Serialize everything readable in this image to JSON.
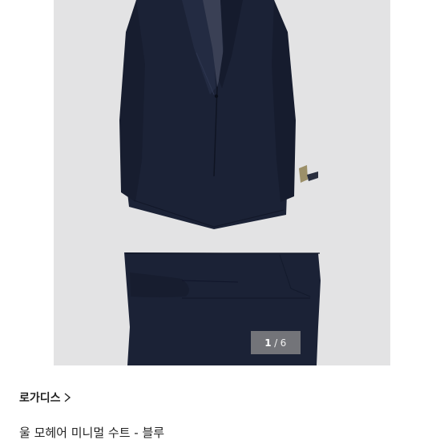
{
  "product": {
    "brand": "로가디스",
    "title": "울 모헤어 미니멀 수트 - 블루",
    "image_alt": "navy suit jacket and trousers"
  },
  "gallery": {
    "current": "1",
    "separator": "/",
    "total": "6"
  },
  "icons": {
    "brand_link": "chevron-right-icon"
  },
  "colors": {
    "gallery_bg": "#e3e3e4",
    "suit": "#1b2236",
    "text": "#222222",
    "counter_bg": "#8c8c8c"
  }
}
